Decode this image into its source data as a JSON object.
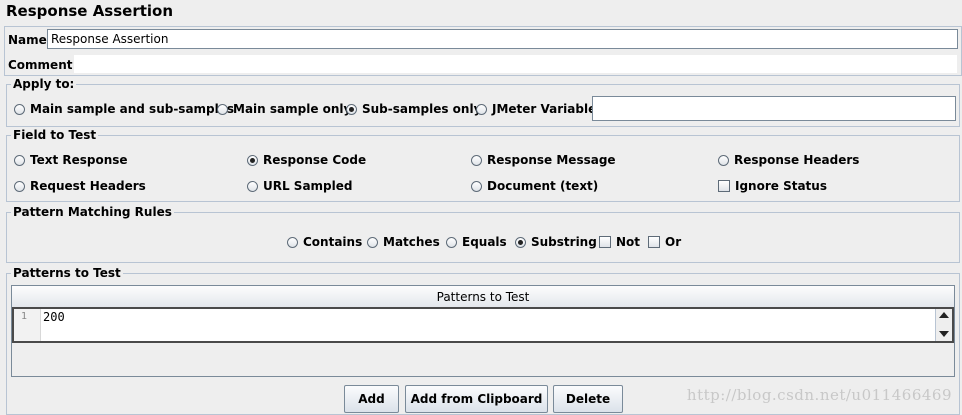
{
  "title": "Response Assertion",
  "name_label": "Name:",
  "name_value": "Response Assertion",
  "comments_label": "Comments:",
  "comments_value": "",
  "apply_to": {
    "legend": "Apply to:",
    "options": [
      {
        "label": "Main sample and sub-samples",
        "selected": false
      },
      {
        "label": "Main sample only",
        "selected": false
      },
      {
        "label": "Sub-samples only",
        "selected": true
      },
      {
        "label": "JMeter Variable",
        "selected": false
      }
    ],
    "variable_value": ""
  },
  "field_to_test": {
    "legend": "Field to Test",
    "options": [
      {
        "label": "Text Response",
        "selected": false
      },
      {
        "label": "Response Code",
        "selected": true
      },
      {
        "label": "Response Message",
        "selected": false
      },
      {
        "label": "Response Headers",
        "selected": false
      },
      {
        "label": "Request Headers",
        "selected": false
      },
      {
        "label": "URL Sampled",
        "selected": false
      },
      {
        "label": "Document (text)",
        "selected": false
      }
    ],
    "ignore_status": {
      "label": "Ignore Status",
      "checked": false
    }
  },
  "pattern_rules": {
    "legend": "Pattern Matching Rules",
    "options": [
      {
        "label": "Contains",
        "selected": false
      },
      {
        "label": "Matches",
        "selected": false
      },
      {
        "label": "Equals",
        "selected": false
      },
      {
        "label": "Substring",
        "selected": true
      }
    ],
    "not": {
      "label": "Not",
      "checked": false
    },
    "or": {
      "label": "Or",
      "checked": false
    }
  },
  "patterns": {
    "legend": "Patterns to Test",
    "column_header": "Patterns to Test",
    "rows": [
      {
        "line": "1",
        "value": "200"
      }
    ]
  },
  "buttons": {
    "add": "Add",
    "add_clipboard": "Add from Clipboard",
    "delete": "Delete"
  },
  "watermark": "http://blog.csdn.net/u011466469"
}
